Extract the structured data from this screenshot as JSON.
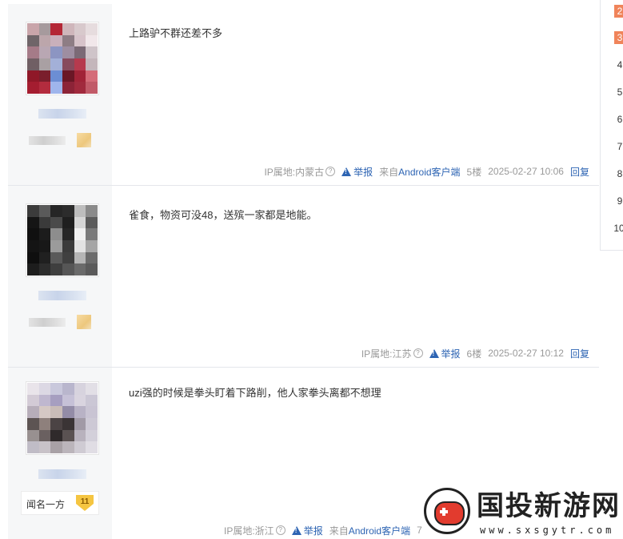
{
  "posts": [
    {
      "content": "上路驴不群还差不多",
      "ip": "IP属地:内蒙古",
      "report": "举报",
      "source_prefix": "来自",
      "source_app": "Android客户端",
      "floor": "5楼",
      "time": "2025-02-27 10:06",
      "reply": "回复",
      "avatar_colors": [
        "#c9a5aa",
        "#a69a9d",
        "#b42736",
        "#cfb6bb",
        "#d8c9cc",
        "#e6dcde",
        "#6f6569",
        "#bca6ab",
        "#c9b0bb",
        "#8e7d85",
        "#d7c3ca",
        "#f1e7ea",
        "#a57b88",
        "#b9a7b3",
        "#8c95c2",
        "#9e8ea1",
        "#7b6a76",
        "#cfc4c9",
        "#705f64",
        "#a9a0a3",
        "#a3b0d8",
        "#874a5d",
        "#b63a4e",
        "#c4b6bb",
        "#8f1828",
        "#7a1e2c",
        "#6c8ed4",
        "#6a1726",
        "#a12337",
        "#d46b78",
        "#a41d30",
        "#b32c3e",
        "#9fb5ec",
        "#8c2337",
        "#a12a3d",
        "#c15a68"
      ]
    },
    {
      "content": "雀食，物资可没48，送殡一家都是地能。",
      "ip": "IP属地:江苏",
      "report": "举报",
      "floor": "6楼",
      "time": "2025-02-27 10:12",
      "reply": "回复",
      "avatar_colors": [
        "#3b3b3b",
        "#5a5a5a",
        "#262626",
        "#2c2c2c",
        "#bdbdbd",
        "#8a8a8a",
        "#151515",
        "#3a3a3a",
        "#4a4a4a",
        "#1f1f1f",
        "#d6d6d6",
        "#5b5b5b",
        "#101010",
        "#1c1c1c",
        "#8d8d8d",
        "#262626",
        "#f1f1f1",
        "#7a7a7a",
        "#141414",
        "#181818",
        "#9b9b9b",
        "#3b3b3b",
        "#e3e3e3",
        "#a5a5a5",
        "#0f0f0f",
        "#202020",
        "#5a5a5a",
        "#404040",
        "#b5b5b5",
        "#6b6b6b",
        "#1d1d1d",
        "#2c2c2c",
        "#3f3f3f",
        "#565656",
        "#6a6a6a",
        "#5a5a5a"
      ]
    },
    {
      "content": "uzi强的时候是拳头盯着下路削，他人家拳头离都不想理",
      "ip": "IP属地:浙江",
      "report": "举报",
      "source_prefix": "来自",
      "source_app": "Android客户端",
      "floor": "7",
      "badge_name": "闻名一方",
      "badge_level": "11",
      "avatar_colors": [
        "#e9e4ea",
        "#dcd8e4",
        "#c9c8dc",
        "#b9b6cd",
        "#d7d3de",
        "#e2dfe6",
        "#d3cbd6",
        "#bfb7cf",
        "#a69ec0",
        "#c6c1d7",
        "#d9d4df",
        "#cbc7d5",
        "#b7aeba",
        "#d5c8c4",
        "#c9bcb8",
        "#938ca7",
        "#b8b2c5",
        "#c9c4d3",
        "#5d5453",
        "#8e807c",
        "#4b4344",
        "#3a3435",
        "#a19aa6",
        "#cdc9d5",
        "#989090",
        "#6a6060",
        "#2f2a2b",
        "#5a5252",
        "#b8b2bd",
        "#d3d0da",
        "#c0bcc6",
        "#c8c2c8",
        "#a8a1a6",
        "#bbb5bb",
        "#cfcbd3",
        "#e0dde4"
      ]
    }
  ],
  "pagination": {
    "pages": [
      "2",
      "3",
      "4",
      "5",
      "6",
      "7",
      "8",
      "9",
      "10"
    ],
    "active": [
      "2",
      "3"
    ]
  },
  "watermark": {
    "title": "国投新游网",
    "url": "www.sxsgytr.com"
  },
  "colors": {
    "link": "#2d64b3",
    "active_page": "#f0845a"
  }
}
